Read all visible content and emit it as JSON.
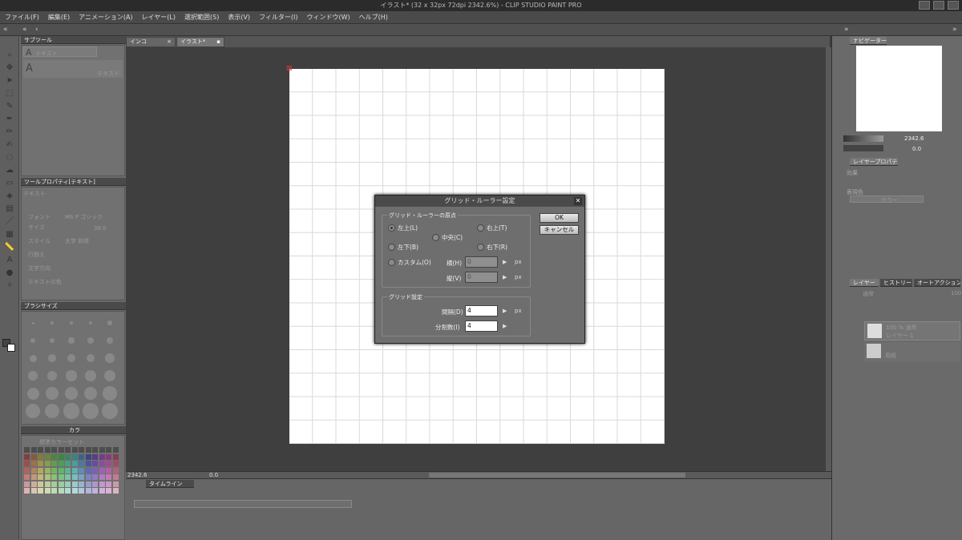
{
  "window": {
    "title": "イラスト* (32 x 32px 72dpi 2342.6%) - CLIP STUDIO PAINT PRO"
  },
  "menu": [
    "ファイル(F)",
    "編集(E)",
    "アニメーション(A)",
    "レイヤー(L)",
    "選択範囲(S)",
    "表示(V)",
    "フィルター(I)",
    "ウィンドウ(W)",
    "ヘルプ(H)"
  ],
  "left": {
    "subtool_header": "サブツール",
    "subtool_group": "テキスト",
    "subtool_item": "テキスト",
    "toolprop_header": "ツールプロパティ[テキスト]",
    "toolprop_title": "テキスト",
    "props": [
      {
        "label": "フォント",
        "value": "MS P ゴシック"
      },
      {
        "label": "サイズ",
        "value": "38.0"
      },
      {
        "label": "スタイル",
        "value": "太字  斜体"
      },
      {
        "label": "行揃え",
        "value": ""
      },
      {
        "label": "文字方向",
        "value": ""
      },
      {
        "label": "テキストの色",
        "value": ""
      }
    ],
    "brushsize_header": "ブラシサイズ",
    "color_header": "カラ",
    "color_set": "標準カラーセット"
  },
  "doc_tabs": [
    "インコ",
    "イラスト*"
  ],
  "status": {
    "zoom": "2342.6",
    "angle": "0.0"
  },
  "timeline_header": "タイムライン",
  "right": {
    "nav_tab": "ナビゲーター",
    "nav_zoom": "2342.6",
    "nav_angle": "0.0",
    "layerprop_tab": "レイヤープロパティ",
    "effect_label": "効果",
    "color_mode_label": "表現色",
    "color_mode_value": "カラー",
    "layer_tab": "レイヤー",
    "history_tab": "ヒストリー",
    "autoaction_tab": "オートアクション",
    "blend": "通常",
    "opacity": "100",
    "layers": [
      {
        "name": "レイヤー 1",
        "meta": "100 % 通常"
      },
      {
        "name": "用紙",
        "meta": ""
      }
    ]
  },
  "dialog": {
    "title": "グリッド・ルーラー設定",
    "origin_group": "グリッド・ルーラーの原点",
    "origins": [
      {
        "label": "左上(L)",
        "selected": true
      },
      {
        "label": "右上(T)",
        "selected": false
      },
      {
        "label": "中央(C)",
        "selected": false
      },
      {
        "label": "左下(B)",
        "selected": false
      },
      {
        "label": "右下(R)",
        "selected": false
      },
      {
        "label": "カスタム(O)",
        "selected": false
      }
    ],
    "h_label": "横(H)",
    "h_value": "0",
    "v_label": "縦(V)",
    "v_value": "0",
    "unit": "px",
    "grid_group": "グリッド設定",
    "gap_label": "間隔(D)",
    "gap_value": "4",
    "div_label": "分割数(I)",
    "div_value": "4",
    "ok": "OK",
    "cancel": "キャンセル"
  }
}
